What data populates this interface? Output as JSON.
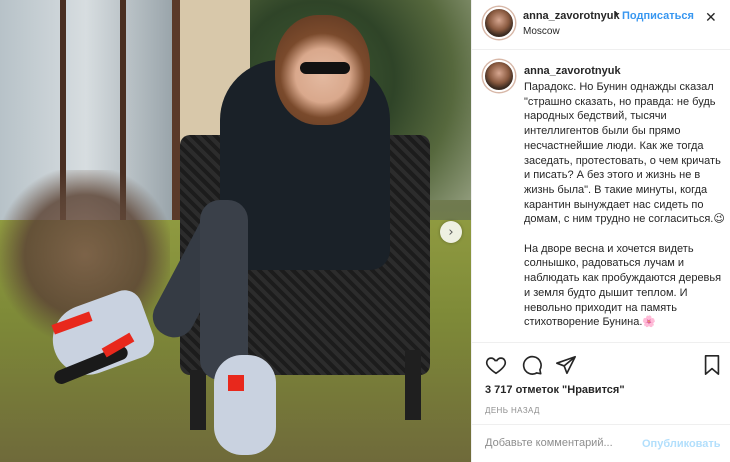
{
  "post": {
    "username": "anna_zavorotnyuk",
    "follow_label": "Подписаться",
    "separator": "•",
    "location": "Moscow",
    "more_icon": "more-icon",
    "caption_username": "anna_zavorotnyuk",
    "caption": "Парадокс. Но Бунин однажды сказал \"страшно сказать, но правда: не будь народных бедствий, тысячи интеллигентов были бы прямо несчастнейшие люди. Как же тогда заседать, протестовать, о чем кричать и писать? А без этого и жизнь не в жизнь была\". В такие минуты, когда карантин вынуждает нас сидеть по домам, с ним трудно не согласиться.😉\n\nНа дворе весна и хочется видеть солнышко, радоваться лучам и наблюдать как пробуждаются деревья и земля будто дышит теплом. И невольно приходит на память стихотворение Бунина.🌸",
    "likes": "3 717 отметок \"Нравится\"",
    "time": "ДЕНЬ НАЗАД",
    "carousel_next_glyph": "›"
  },
  "comment": {
    "placeholder": "Добавьте комментарий...",
    "publish_label": "Опубликовать"
  },
  "colors": {
    "accent": "#3897f0",
    "publish_disabled": "#b2dffc",
    "muted": "#8e8e8e",
    "text": "#262626"
  }
}
